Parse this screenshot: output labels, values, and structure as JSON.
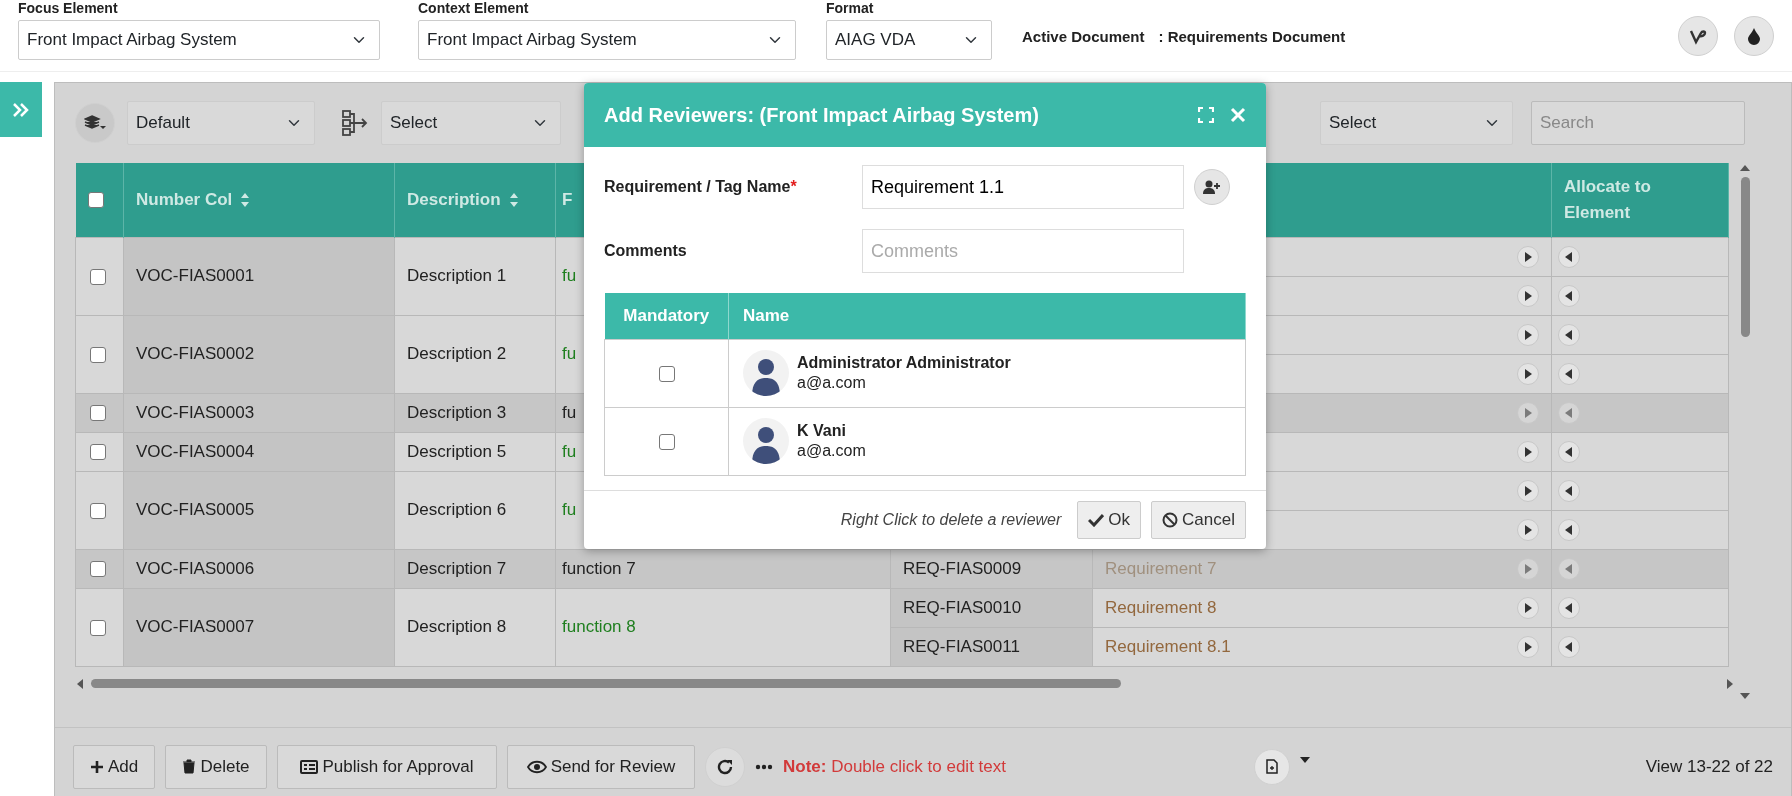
{
  "top_bar": {
    "fields": [
      {
        "label": "Focus Element",
        "value": "Front Impact Airbag System"
      },
      {
        "label": "Context Element",
        "value": "Front Impact Airbag System"
      },
      {
        "label": "Format",
        "value": "AIAG VDA"
      }
    ],
    "active_document": {
      "label": "Active Document",
      "value": ": Requirements Document"
    }
  },
  "toolbar": {
    "view": "Default",
    "group_by": "Select",
    "filter": "Select",
    "search": {
      "placeholder": "Search"
    }
  },
  "table": {
    "all_selected": false,
    "columns": [
      {
        "label": "Number Col",
        "sortable": true
      },
      {
        "label": "Description",
        "sortable": true
      },
      {
        "label": "F",
        "sortable": false
      },
      {
        "label": "Allocate to Element",
        "sortable": false
      }
    ],
    "rows": [
      {
        "selected": false,
        "highlighted": false,
        "number": "VOC-FIAS0001",
        "description": "Description 1",
        "function": "fu",
        "links": [
          {
            "kind": "covered"
          },
          {
            "kind": "covered"
          }
        ]
      },
      {
        "selected": false,
        "highlighted": false,
        "number": "VOC-FIAS0002",
        "description": "Description 2",
        "function": "fu",
        "links": [
          {
            "kind": "covered"
          },
          {
            "kind": "covered"
          }
        ]
      },
      {
        "selected": false,
        "highlighted": true,
        "number": "VOC-FIAS0003",
        "description": "Description 3",
        "function": "fu",
        "links": [
          {
            "kind": "covered"
          }
        ]
      },
      {
        "selected": false,
        "highlighted": false,
        "number": "VOC-FIAS0004",
        "description": "Description 5",
        "function": "fu",
        "links": [
          {
            "kind": "covered"
          }
        ]
      },
      {
        "selected": false,
        "highlighted": false,
        "number": "VOC-FIAS0005",
        "description": "Description 6",
        "function": "fu",
        "links": [
          {
            "kind": "covered"
          },
          {
            "kind": "covered"
          }
        ]
      },
      {
        "selected": false,
        "highlighted": true,
        "number": "VOC-FIAS0006",
        "description": "Description 7",
        "function": "function 7",
        "links": [
          {
            "kind": "text",
            "req_id": "REQ-FIAS0009",
            "requirement": "Requirement 7"
          }
        ]
      },
      {
        "selected": false,
        "highlighted": false,
        "number": "VOC-FIAS0007",
        "description": "Description 8",
        "function": "function 8",
        "links": [
          {
            "kind": "text",
            "req_id": "REQ-FIAS0010",
            "requirement": "Requirement 8"
          },
          {
            "kind": "text",
            "req_id": "REQ-FIAS0011",
            "requirement": "Requirement 8.1"
          }
        ]
      }
    ]
  },
  "footer": {
    "buttons": [
      {
        "label": "Add",
        "kind": "add"
      },
      {
        "label": "Delete",
        "kind": "delete"
      },
      {
        "label": "Publish for Approval",
        "kind": "publish"
      },
      {
        "label": "Send for Review",
        "kind": "review"
      }
    ],
    "note": "**Note:** Double click to edit text",
    "pager": "View 13-22 of 22"
  },
  "modal": {
    "title": "Add Reviewers: (Front Impact Airbag System)",
    "fields": [
      {
        "label": "Requirement / Tag Name",
        "required_mark": "*",
        "value": "Requirement 1.1"
      },
      {
        "label": "Comments",
        "placeholder": "Comments"
      }
    ],
    "reviewers": {
      "columns": [
        "Mandatory",
        "Name"
      ],
      "rows": [
        {
          "mandatory": false,
          "name": "Administrator Administrator",
          "email": "a@a.com"
        },
        {
          "mandatory": false,
          "name": "K Vani",
          "email": "a@a.com"
        }
      ]
    },
    "hint": "Right Click to delete a reviewer",
    "buttons": [
      {
        "label": "Ok",
        "kind": "ok"
      },
      {
        "label": "Cancel",
        "kind": "cancel"
      }
    ]
  }
}
